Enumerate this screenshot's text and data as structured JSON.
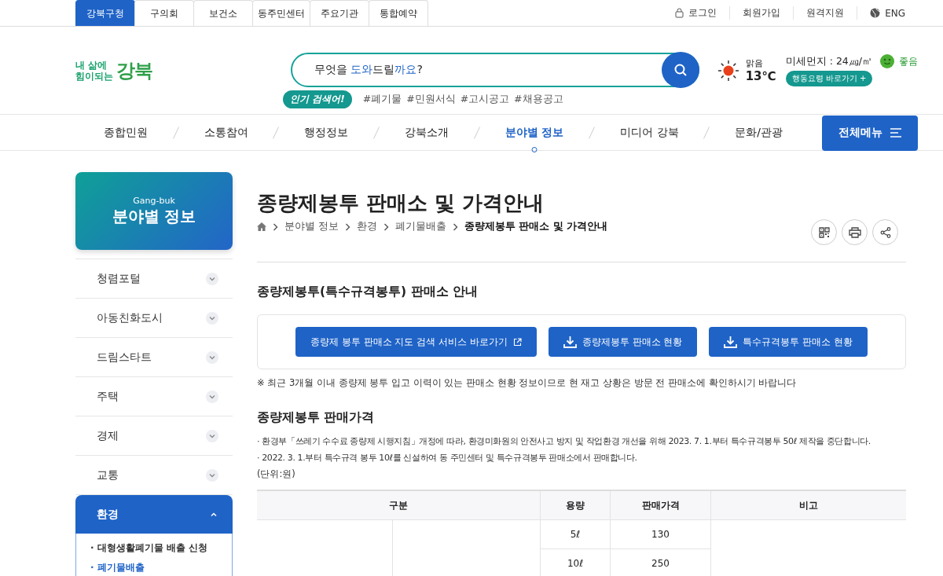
{
  "top_tabs": [
    {
      "label": "강북구청",
      "selected": true
    },
    {
      "label": "구의회",
      "selected": false
    },
    {
      "label": "보건소",
      "selected": false
    },
    {
      "label": "동주민센터",
      "selected": false
    },
    {
      "label": "주요기관",
      "selected": false
    },
    {
      "label": "통합예약",
      "selected": false
    }
  ],
  "util_links": [
    {
      "label": "로그인",
      "kind": "lock"
    },
    {
      "label": "회원가입",
      "kind": "plain"
    },
    {
      "label": "원격지원",
      "kind": "plain"
    },
    {
      "label": "ENG",
      "kind": "globe"
    }
  ],
  "logo": {
    "line1": "내 삶에",
    "line2": "힘이되는",
    "name": "강북"
  },
  "search": {
    "placeholder": [
      {
        "text": "무엇을 ",
        "highlight": false
      },
      {
        "text": "도와",
        "highlight": true
      },
      {
        "text": "드릴",
        "highlight": false
      },
      {
        "text": "까요",
        "highlight": true
      },
      {
        "text": "?",
        "highlight": false
      }
    ],
    "popular_label": "인기 검색어!",
    "keywords": [
      "#폐기물",
      "#민원서식",
      "#고시공고",
      "#채용공고"
    ]
  },
  "weather": {
    "condition": "맑음",
    "temperature": "13℃",
    "dust": "미세먼지 : 24㎍/㎥",
    "dust_grade": "좋음",
    "guide_button": "행동요령 바로가기 +"
  },
  "nav": [
    {
      "label": "종합민원",
      "selected": false
    },
    {
      "label": "소통참여",
      "selected": false
    },
    {
      "label": "행정정보",
      "selected": false
    },
    {
      "label": "강북소개",
      "selected": false
    },
    {
      "label": "분야별 정보",
      "selected": true
    },
    {
      "label": "미디어 강북",
      "selected": false
    },
    {
      "label": "문화/관광",
      "selected": false
    }
  ],
  "all_menu_button": "전체메뉴",
  "sidebar": {
    "subtitle": "Gang-buk",
    "title": "분야별 정보",
    "items": [
      {
        "label": "청렴포털",
        "expanded": false
      },
      {
        "label": "아동친화도시",
        "expanded": false
      },
      {
        "label": "드림스타트",
        "expanded": false
      },
      {
        "label": "주택",
        "expanded": false
      },
      {
        "label": "경제",
        "expanded": false
      },
      {
        "label": "교통",
        "expanded": false
      },
      {
        "label": "환경",
        "expanded": true,
        "children": [
          {
            "label": "· 대형생활폐기물 배출 신청",
            "selected": false
          },
          {
            "label": "· 폐기물배출",
            "selected": true
          }
        ]
      }
    ]
  },
  "page_title": "종량제봉투 판매소 및 가격안내",
  "breadcrumb": [
    "분야별 정보",
    "환경",
    "폐기물배출",
    "종량제봉투 판매소 및 가격안내"
  ],
  "section1": {
    "heading": "종량제봉투(특수규격봉투) 판매소 안내",
    "buttons": [
      {
        "label": "종량제 봉투 판매소 지도 검색 서비스 바로가기",
        "kind": "external"
      },
      {
        "label": "종량제봉투 판매소 현황",
        "kind": "download"
      },
      {
        "label": "특수규격봉투 판매소 현황",
        "kind": "download"
      }
    ],
    "note": "※ 최근 3개월 이내 종량제 봉투 입고 이력이 있는 판매소 현황 정보이므로 현 재고 상황은 방문 전 판매소에 확인하시기 바랍니다"
  },
  "section2": {
    "heading": "종량제봉투 판매가격",
    "bullets": [
      "· 환경부「쓰레기 수수료 종량제 시행지침」개정에 따라, 환경미화원의 안전사고 방지 및 작업환경 개선을 위해 2023. 7. 1.부터 특수규격봉투 50ℓ 제작을 중단합니다.",
      "· 2022. 3. 1.부터 특수규격 봉투 10ℓ를 신설하여 동 주민센터 및 특수규격봉투 판매소에서 판매합니다."
    ],
    "unit": "(단위:원)",
    "table": {
      "columns": [
        "구분",
        "용량",
        "판매가격",
        "비고"
      ],
      "rows": [
        [
          "",
          "5ℓ",
          "130",
          ""
        ],
        [
          "",
          "10ℓ",
          "250",
          ""
        ]
      ]
    }
  }
}
